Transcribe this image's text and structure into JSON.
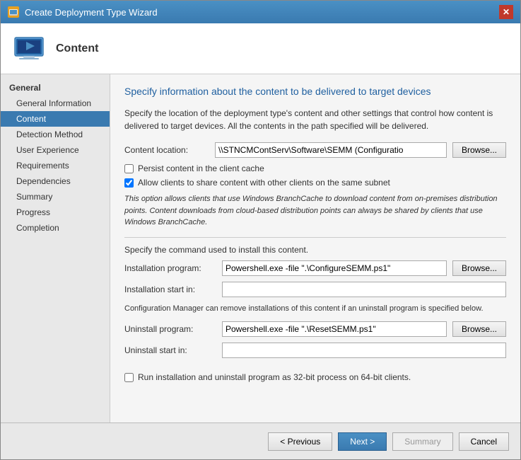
{
  "window": {
    "title": "Create Deployment Type Wizard",
    "close_label": "✕"
  },
  "header": {
    "icon_label": "computer-icon",
    "section_title": "Content"
  },
  "sidebar": {
    "section_label": "General",
    "items": [
      {
        "id": "general-information",
        "label": "General Information",
        "active": false
      },
      {
        "id": "content",
        "label": "Content",
        "active": true
      },
      {
        "id": "detection-method",
        "label": "Detection Method",
        "active": false
      },
      {
        "id": "user-experience",
        "label": "User Experience",
        "active": false
      },
      {
        "id": "requirements",
        "label": "Requirements",
        "active": false
      },
      {
        "id": "dependencies",
        "label": "Dependencies",
        "active": false
      },
      {
        "id": "summary",
        "label": "Summary",
        "active": false
      },
      {
        "id": "progress",
        "label": "Progress",
        "active": false
      },
      {
        "id": "completion",
        "label": "Completion",
        "active": false
      }
    ]
  },
  "content": {
    "heading": "Specify information about the content to be delivered to target devices",
    "description": "Specify the location of the deployment type's content and other settings that control how content is delivered to target devices. All the contents in the path specified will be delivered.",
    "content_location_label": "Content location:",
    "content_location_value": "\\\\STNCMContServ\\Software\\SEMM (Configuratio",
    "browse_label": "Browse...",
    "persist_cache_label": "Persist content in the client cache",
    "persist_cache_checked": false,
    "allow_share_label": "Allow clients to share content with other clients on the same subnet",
    "allow_share_checked": true,
    "branch_cache_info": "This option allows clients that use Windows BranchCache to download content from on-premises distribution points. Content downloads from cloud-based distribution points can always be shared by clients that use Windows BranchCache.",
    "install_section_label": "Specify the command used to install this content.",
    "installation_program_label": "Installation program:",
    "installation_program_value": "Powershell.exe -file \".\\ConfigureSEMM.ps1\"",
    "installation_start_label": "Installation start in:",
    "installation_start_value": "",
    "config_note": "Configuration Manager can remove installations of this content if an uninstall program is specified below.",
    "uninstall_program_label": "Uninstall program:",
    "uninstall_program_value": "Powershell.exe -file \".\\ResetSEMM.ps1\"",
    "uninstall_start_label": "Uninstall start in:",
    "uninstall_start_value": "",
    "run_32bit_label": "Run installation and uninstall program as 32-bit process on 64-bit clients.",
    "run_32bit_checked": false
  },
  "footer": {
    "previous_label": "< Previous",
    "next_label": "Next >",
    "summary_label": "Summary",
    "cancel_label": "Cancel"
  }
}
